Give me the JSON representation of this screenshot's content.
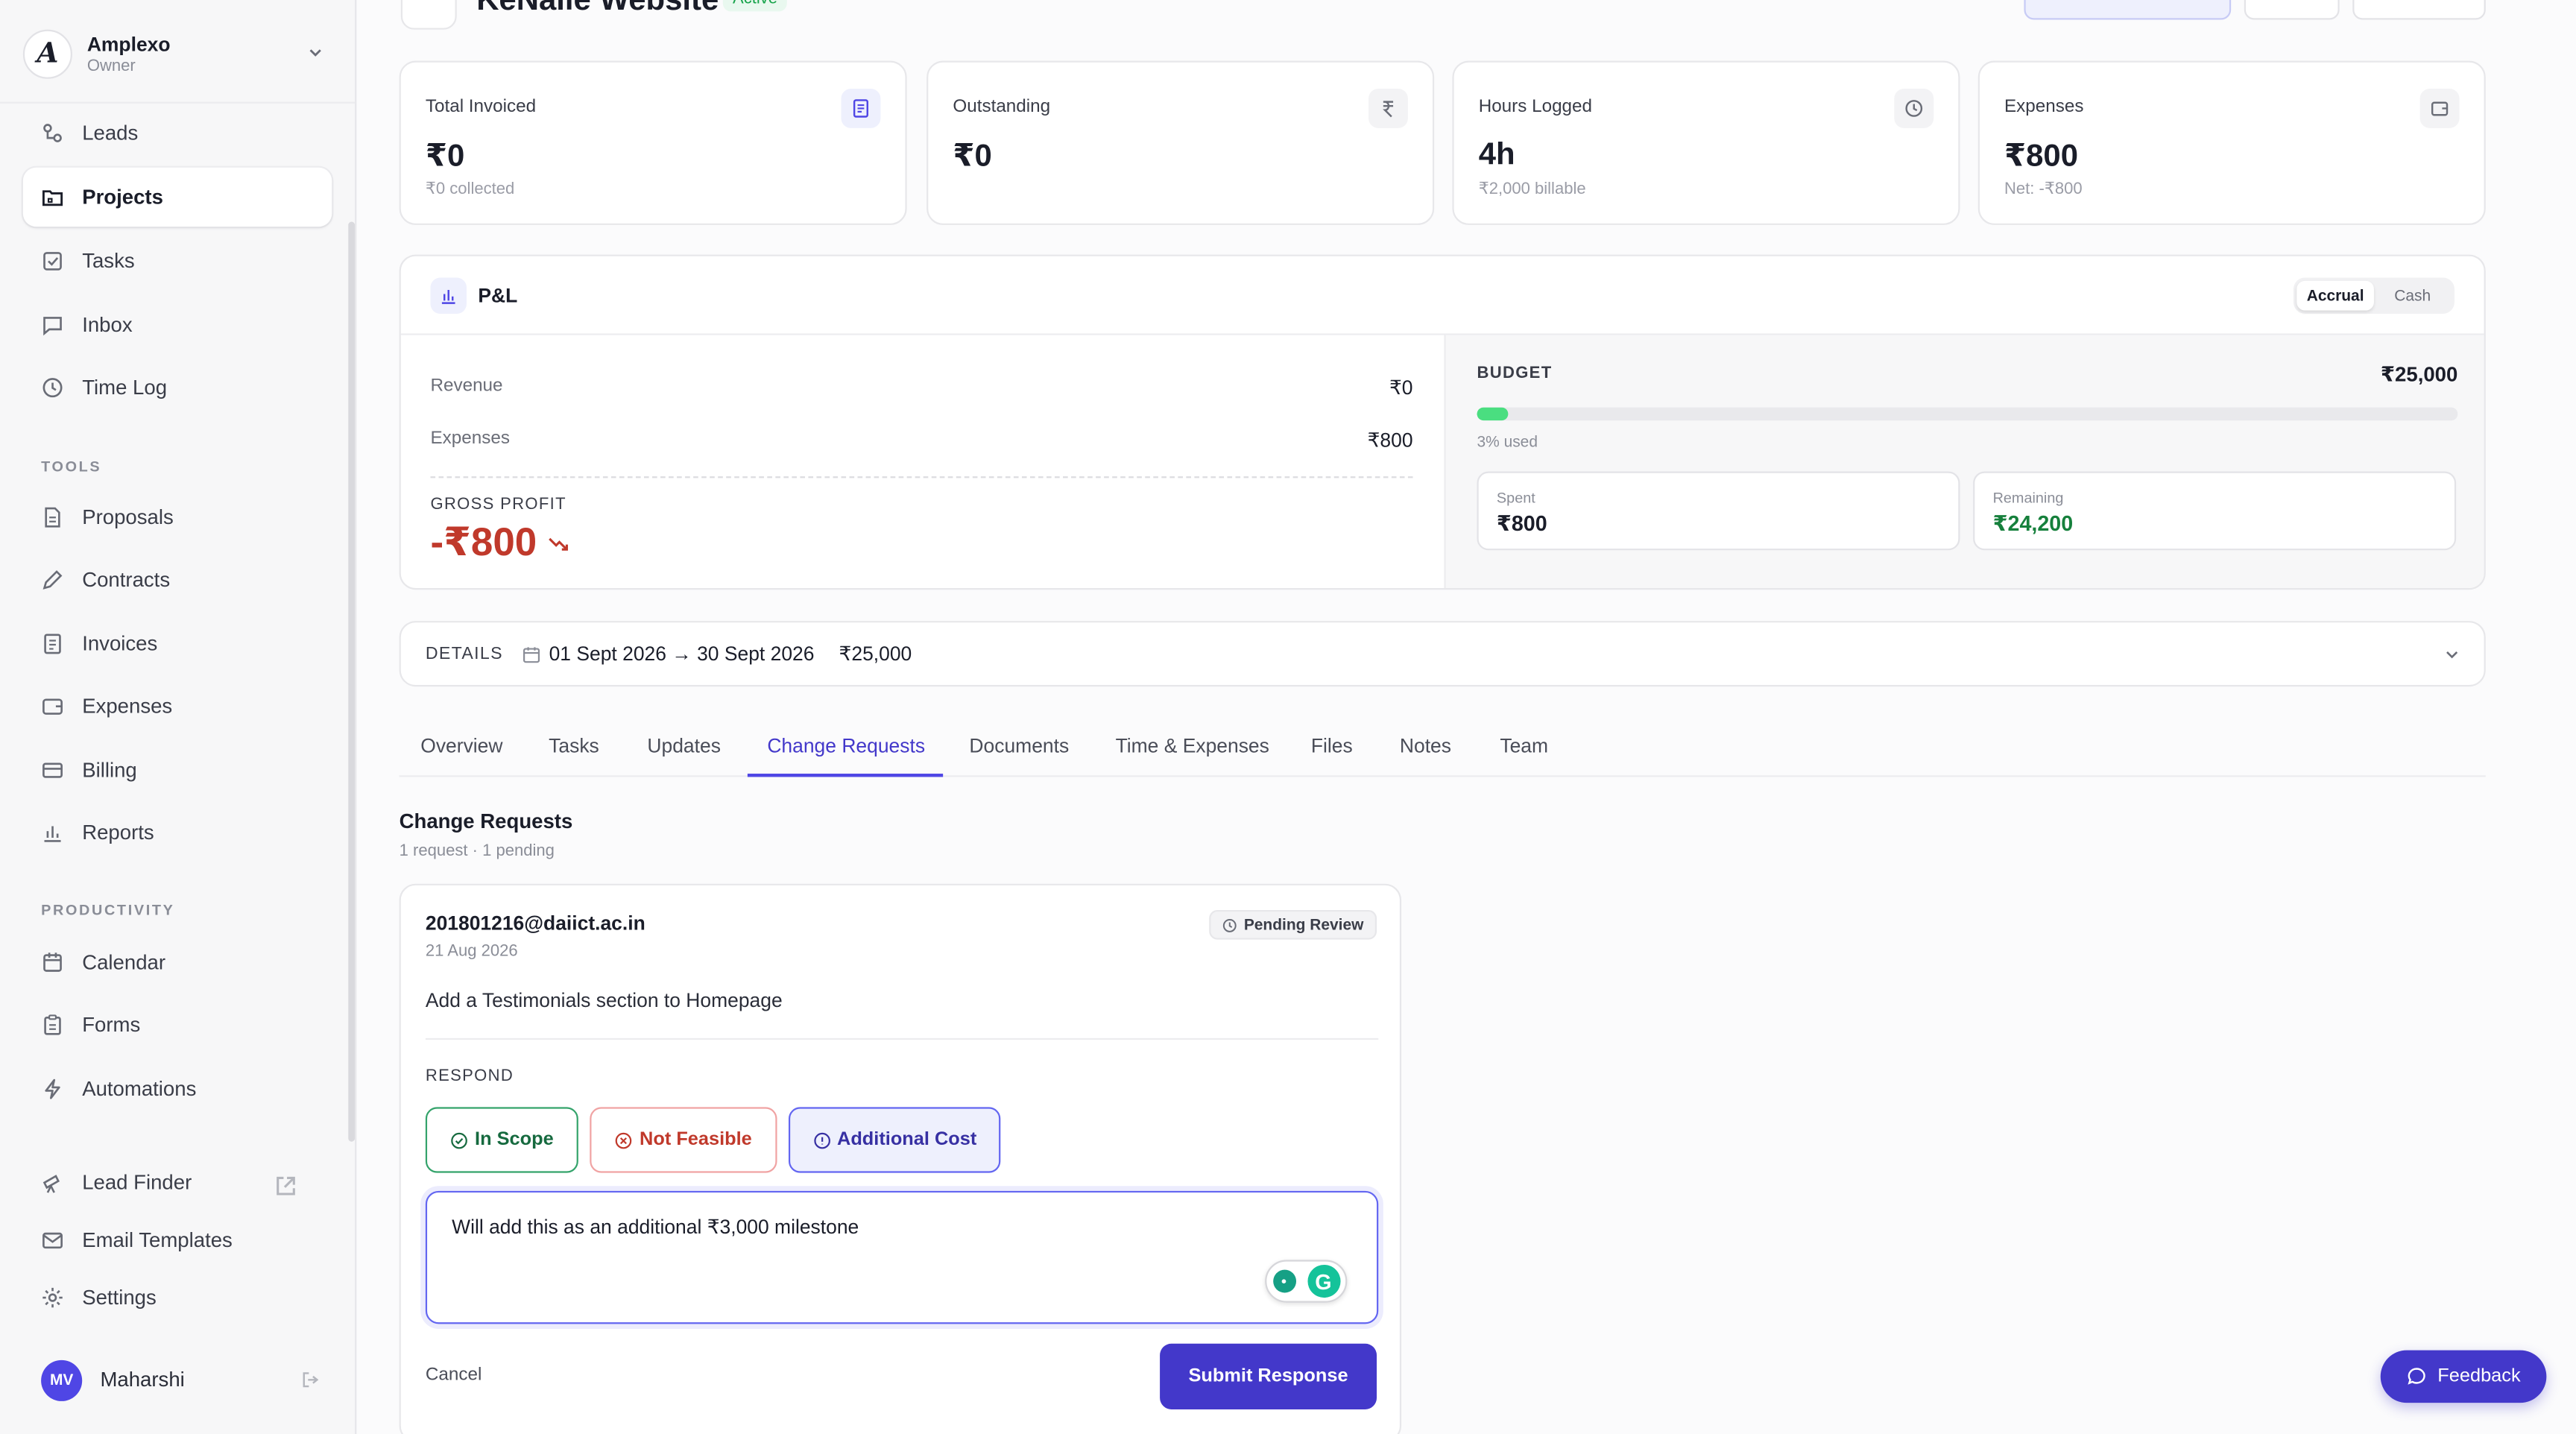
{
  "workspace": {
    "name": "Amplexo",
    "role": "Owner"
  },
  "nav": {
    "leads": "Leads",
    "projects": "Projects",
    "tasks": "Tasks",
    "inbox": "Inbox",
    "time_log": "Time Log",
    "tools_section": "TOOLS",
    "proposals": "Proposals",
    "contracts": "Contracts",
    "invoices": "Invoices",
    "expenses": "Expenses",
    "billing": "Billing",
    "reports": "Reports",
    "productivity_section": "PRODUCTIVITY",
    "calendar": "Calendar",
    "forms": "Forms",
    "automations": "Automations",
    "lead_finder": "Lead Finder",
    "email_templates": "Email Templates",
    "settings": "Settings"
  },
  "user": {
    "initials": "MV",
    "name": "Maharshi"
  },
  "project": {
    "title": "KeNaile Website",
    "status": "Active"
  },
  "stats": [
    {
      "label": "Total Invoiced",
      "value": "₹0",
      "sub": "₹0 collected"
    },
    {
      "label": "Outstanding",
      "value": "₹0",
      "sub": ""
    },
    {
      "label": "Hours Logged",
      "value": "4h",
      "sub": "₹2,000 billable"
    },
    {
      "label": "Expenses",
      "value": "₹800",
      "sub": "Net: -₹800"
    }
  ],
  "pl": {
    "title": "P&L",
    "toggle": {
      "accrual": "Accrual",
      "cash": "Cash",
      "selected": "Accrual"
    },
    "revenue_label": "Revenue",
    "revenue_value": "₹0",
    "expenses_label": "Expenses",
    "expenses_value": "₹800",
    "gross_profit_label": "GROSS PROFIT",
    "gross_profit_value": "-₹800",
    "budget_label": "BUDGET",
    "budget_total": "₹25,000",
    "budget_used_fraction": 0.032,
    "budget_used_text": "3% used",
    "spent_label": "Spent",
    "spent_value": "₹800",
    "remaining_label": "Remaining",
    "remaining_value": "₹24,200"
  },
  "details": {
    "label": "DETAILS",
    "dates": "01 Sept 2026 → 30 Sept 2026",
    "amount": "₹25,000"
  },
  "tabs": [
    "Overview",
    "Tasks",
    "Updates",
    "Change Requests",
    "Documents",
    "Time & Expenses",
    "Files",
    "Notes",
    "Team"
  ],
  "active_tab": "Change Requests",
  "change_requests": {
    "title": "Change Requests",
    "subtitle": "1 request · 1 pending",
    "item": {
      "email": "201801216@daiict.ac.in",
      "date": "21 Aug 2026",
      "status": "Pending Review",
      "description": "Add a Testimonials section to Homepage",
      "respond_label": "RESPOND",
      "options": {
        "in_scope": "In Scope",
        "not_feasible": "Not Feasible",
        "additional_cost": "Additional Cost"
      },
      "selected_option": "Additional Cost",
      "response_text": "Will add this as an additional ₹3,000 milestone",
      "cancel_label": "Cancel",
      "submit_label": "Submit Response"
    }
  },
  "feedback_label": "Feedback",
  "colors": {
    "accent": "#4338ca",
    "success": "#16803c",
    "danger": "#c0392b",
    "budget_bar": "#4ade80"
  }
}
